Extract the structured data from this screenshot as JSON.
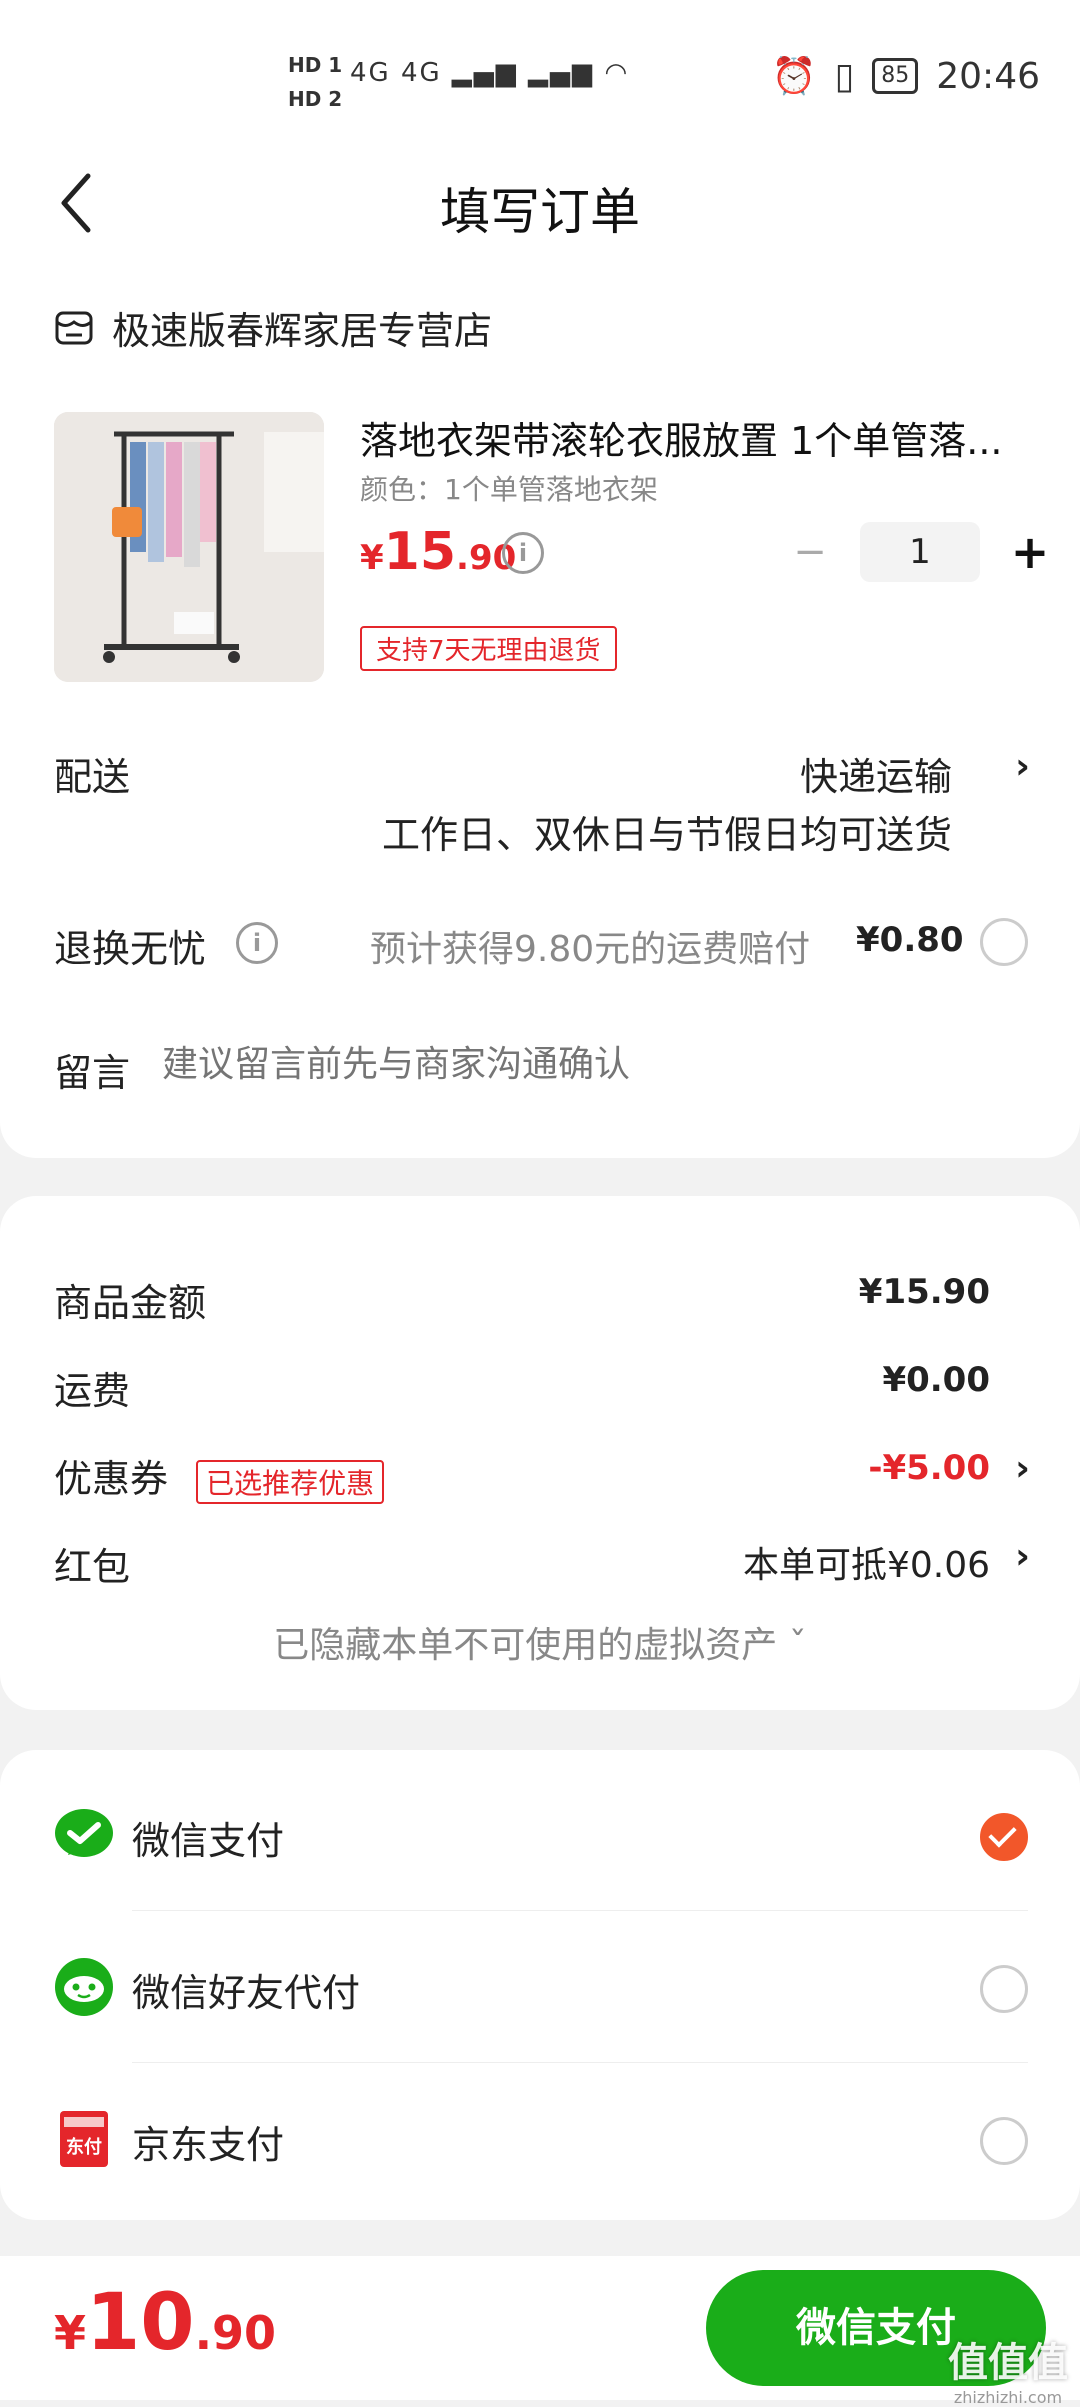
{
  "status_bar": {
    "sim1": "HD 1",
    "sim2": "HD 2",
    "network": "4G 4G",
    "battery": "85",
    "time": "20:46"
  },
  "header": {
    "title": "填写订单"
  },
  "store": {
    "name": "极速版春辉家居专营店"
  },
  "product": {
    "title": "落地衣架带滚轮衣服放置 1个单管落...",
    "spec": "颜色：1个单管落地衣架",
    "price_currency": "¥",
    "price_int": "15",
    "price_dec": ".90",
    "quantity": "1",
    "return_tag": "支持7天无理由退货"
  },
  "delivery": {
    "label": "配送",
    "method": "快递运输",
    "note": "工作日、双休日与节假日均可送货"
  },
  "return_insurance": {
    "label": "退换无忧",
    "desc": "预计获得9.80元的运费赔付",
    "price": "¥0.80"
  },
  "message": {
    "label": "留言",
    "placeholder": "建议留言前先与商家沟通确认"
  },
  "amounts": {
    "goods_label": "商品金额",
    "goods_value": "¥15.90",
    "shipping_label": "运费",
    "shipping_value": "¥0.00",
    "coupon_label": "优惠券",
    "coupon_tag": "已选推荐优惠",
    "coupon_value": "-¥5.00",
    "redpacket_label": "红包",
    "redpacket_value": "本单可抵¥0.06",
    "hidden_assets": "已隐藏本单不可使用的虚拟资产 ˇ"
  },
  "payment_methods": [
    {
      "name": "微信支付",
      "selected": true
    },
    {
      "name": "微信好友代付",
      "selected": false
    },
    {
      "name": "京东支付",
      "selected": false
    }
  ],
  "bottom": {
    "total_currency": "¥",
    "total_int": "10",
    "total_dec": ".90",
    "pay_button": "微信支付"
  },
  "watermark": {
    "main": "值值值",
    "sub": "zhizhizhi.com"
  },
  "colors": {
    "price_red": "#e4262b",
    "wechat_green": "#1aad19",
    "radio_selected": "#f2572a"
  }
}
